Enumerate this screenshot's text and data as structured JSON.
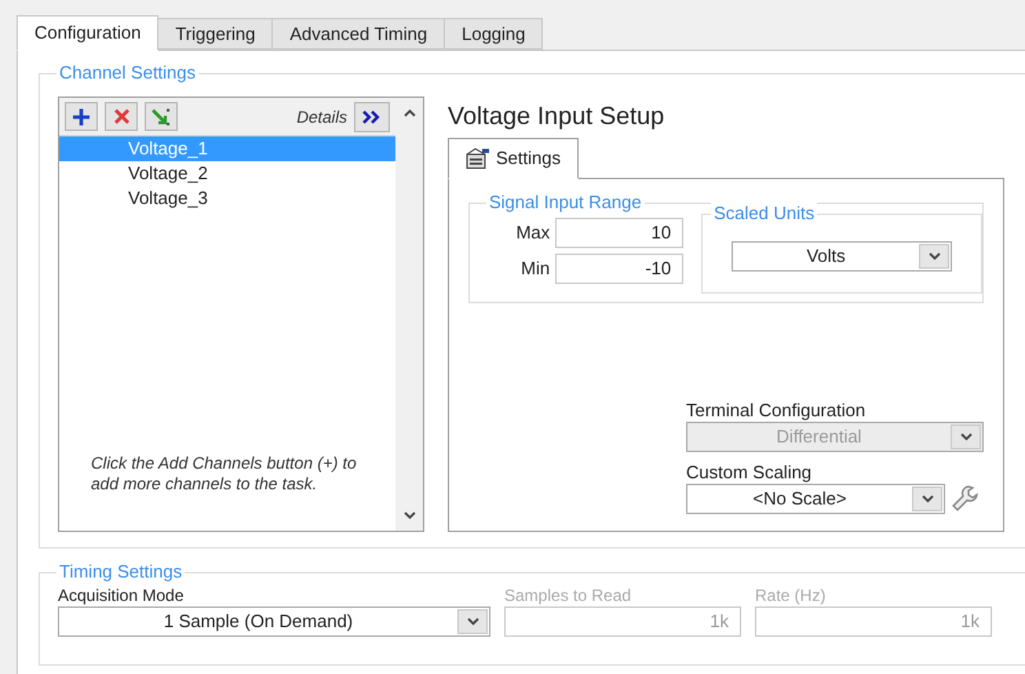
{
  "tabs": [
    {
      "label": "Configuration",
      "selected": true
    },
    {
      "label": "Triggering",
      "selected": false
    },
    {
      "label": "Advanced Timing",
      "selected": false
    },
    {
      "label": "Logging",
      "selected": false
    }
  ],
  "channel_settings": {
    "title": "Channel Settings",
    "details_label": "Details",
    "channels": [
      {
        "name": "Voltage_1",
        "selected": true
      },
      {
        "name": "Voltage_2",
        "selected": false
      },
      {
        "name": "Voltage_3",
        "selected": false
      }
    ],
    "hint": "Click the Add Channels button (+) to add more channels to the task."
  },
  "setup": {
    "title": "Voltage Input Setup",
    "tabs": [
      {
        "label": "Settings",
        "selected": true
      }
    ],
    "signal_input_range": {
      "title": "Signal Input Range",
      "max": {
        "label": "Max",
        "value": "10"
      },
      "min": {
        "label": "Min",
        "value": "-10"
      }
    },
    "scaled_units": {
      "title": "Scaled Units",
      "value": "Volts"
    },
    "terminal_configuration": {
      "label": "Terminal Configuration",
      "value": "Differential",
      "disabled": true
    },
    "custom_scaling": {
      "label": "Custom Scaling",
      "value": "<No Scale>",
      "disabled": false
    }
  },
  "timing_settings": {
    "title": "Timing Settings",
    "acquisition_mode": {
      "label": "Acquisition Mode",
      "value": "1 Sample (On Demand)",
      "disabled": false
    },
    "samples_to_read": {
      "label": "Samples to Read",
      "value": "1k",
      "disabled": true
    },
    "rate": {
      "label": "Rate (Hz)",
      "value": "1k",
      "disabled": true
    }
  }
}
